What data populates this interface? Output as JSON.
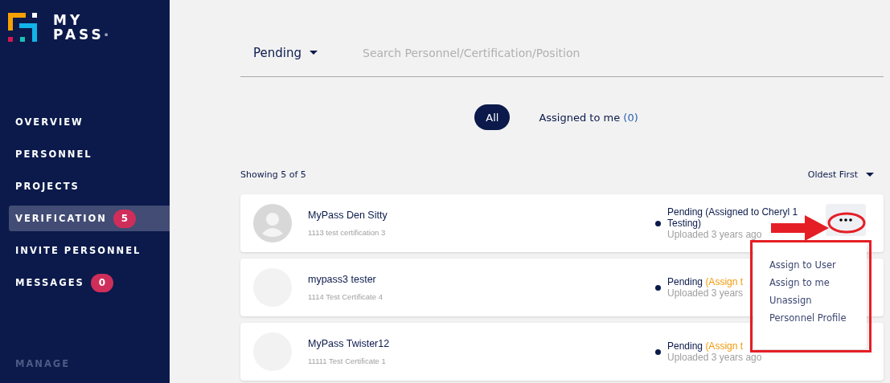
{
  "logo": {
    "line_1": "MY",
    "line_2": "PASS",
    "mark": "®"
  },
  "sidebar": {
    "items": [
      {
        "label": "OVERVIEW",
        "selected": false
      },
      {
        "label": "PERSONNEL",
        "selected": false
      },
      {
        "label": "PROJECTS",
        "selected": false
      },
      {
        "label": "VERIFICATION",
        "selected": true,
        "badge": "5"
      },
      {
        "label": "INVITE PERSONNEL",
        "selected": false
      },
      {
        "label": "MESSAGES",
        "selected": false,
        "badge": "0"
      }
    ],
    "section": "MANAGE"
  },
  "filter": {
    "value": "Pending"
  },
  "search": {
    "placeholder": "Search Personnel/Certification/Position"
  },
  "tabs": [
    {
      "label": "All",
      "selected": true
    },
    {
      "label": "Assigned to me",
      "count": "(0)",
      "selected": false
    }
  ],
  "showing": "Showing 5 of 5",
  "sort": "Oldest First",
  "cards": [
    {
      "silhouette": true,
      "name": "MyPass Den Sitty",
      "certificate": "1113 test certification 3",
      "status": "Pending (Assigned to Cheryl 1 Testing)",
      "uploaded": "Uploaded 3 years ago",
      "actions": true
    },
    {
      "silhouette": false,
      "name": "mypass3 tester",
      "certificate": "1114 Test Certificate 4",
      "status": "Pending",
      "assign": "(Assign t",
      "uploaded": "Uploaded 3 years",
      "actions": false
    },
    {
      "silhouette": false,
      "name": "MyPass Twister12",
      "certificate": "11111 Test Certificate 1",
      "status": "Pending",
      "assign": "(Assign t",
      "uploaded": "Uploaded 3 years ago",
      "actions": false
    }
  ],
  "menu": {
    "items": [
      "Assign to User",
      "Assign to me",
      "Unassign",
      "Personnel Profile"
    ]
  }
}
